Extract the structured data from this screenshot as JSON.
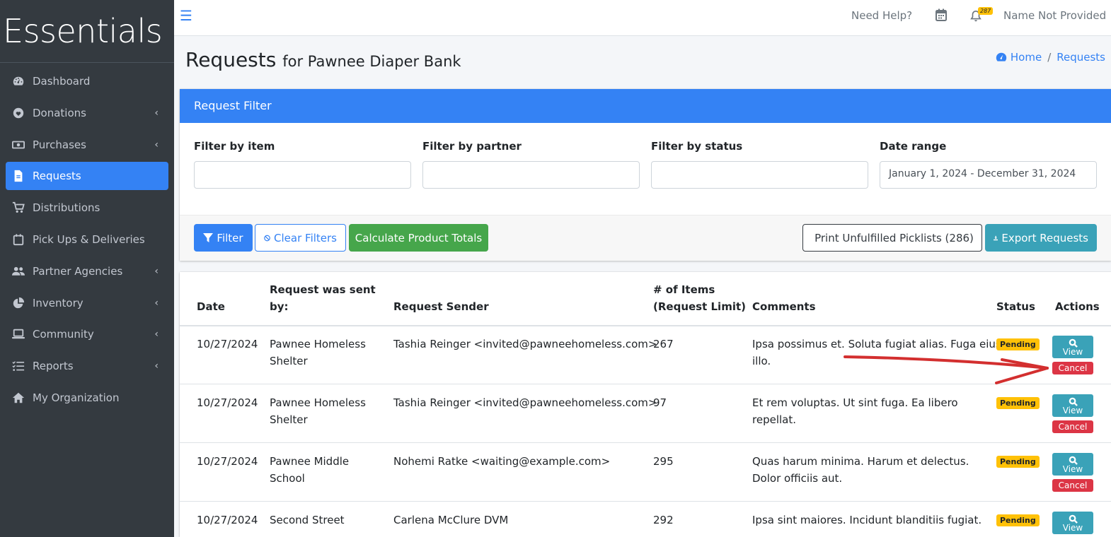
{
  "brand": {
    "name": "Essentials"
  },
  "sidebar": {
    "items": [
      {
        "label": "Dashboard",
        "icon": "dashboard-icon",
        "chevron": false,
        "active": false
      },
      {
        "label": "Donations",
        "icon": "heart-icon",
        "chevron": true,
        "active": false
      },
      {
        "label": "Purchases",
        "icon": "money-bill-icon",
        "chevron": true,
        "active": false
      },
      {
        "label": "Requests",
        "icon": "file-icon",
        "chevron": false,
        "active": true
      },
      {
        "label": "Distributions",
        "icon": "cart-icon",
        "chevron": false,
        "active": false
      },
      {
        "label": "Pick Ups & Deliveries",
        "icon": "calendar-icon",
        "chevron": false,
        "active": false
      },
      {
        "label": "Partner Agencies",
        "icon": "users-icon",
        "chevron": true,
        "active": false
      },
      {
        "label": "Inventory",
        "icon": "pie-chart-icon",
        "chevron": true,
        "active": false
      },
      {
        "label": "Community",
        "icon": "laptop-icon",
        "chevron": true,
        "active": false
      },
      {
        "label": "Reports",
        "icon": "list-check-icon",
        "chevron": true,
        "active": false
      },
      {
        "label": "My Organization",
        "icon": "home-icon",
        "chevron": false,
        "active": false
      }
    ]
  },
  "topbar": {
    "help_label": "Need Help?",
    "notification_count": "287",
    "user_name": "Name Not Provided"
  },
  "header": {
    "title": "Requests",
    "subtitle": "for Pawnee Diaper Bank",
    "breadcrumb": {
      "home": "Home",
      "current": "Requests"
    }
  },
  "filter": {
    "title": "Request Filter",
    "item_label": "Filter by item",
    "item_value": "",
    "partner_label": "Filter by partner",
    "partner_value": "",
    "status_label": "Filter by status",
    "status_value": "",
    "date_label": "Date range",
    "date_value": "January 1, 2024 - December 31, 2024",
    "filter_button": "Filter",
    "clear_button": "Clear Filters",
    "calculate_button": "Calculate Product Totals",
    "print_button": "Print Unfulfilled Picklists (286)",
    "export_button": "Export Requests"
  },
  "table": {
    "headers": {
      "date": "Date",
      "sent_by_1": "Request was sent",
      "sent_by_2": "by:",
      "sender": "Request Sender",
      "items_1": "# of Items",
      "items_2": "(Request Limit)",
      "comments": "Comments",
      "status": "Status",
      "actions": "Actions"
    },
    "view_label": "View",
    "cancel_label": "Cancel",
    "rows": [
      {
        "date": "10/27/2024",
        "sent_by_1": "Pawnee Homeless",
        "sent_by_2": "Shelter",
        "sender": "Tashia Reinger <invited@pawneehomeless.com>",
        "items": "267",
        "comments_1": "Ipsa possimus et. Soluta fugiat alias. Fuga eius",
        "comments_2": "illo.",
        "status": "Pending"
      },
      {
        "date": "10/27/2024",
        "sent_by_1": "Pawnee Homeless",
        "sent_by_2": "Shelter",
        "sender": "Tashia Reinger <invited@pawneehomeless.com>",
        "items": "97",
        "comments_1": "Et rem voluptas. Ut sint fuga. Ea libero",
        "comments_2": "repellat.",
        "status": "Pending"
      },
      {
        "date": "10/27/2024",
        "sent_by_1": "Pawnee Middle",
        "sent_by_2": "School",
        "sender": "Nohemi Ratke <waiting@example.com>",
        "items": "295",
        "comments_1": "Quas harum minima. Harum et delectus.",
        "comments_2": "Dolor officiis aut.",
        "status": "Pending"
      },
      {
        "date": "10/27/2024",
        "sent_by_1": "Second Street",
        "sent_by_2": "",
        "sender": "Carlena McClure DVM",
        "items": "292",
        "comments_1": "Ipsa sint maiores. Incidunt blanditiis fugiat.",
        "comments_2": "",
        "status": "Pending"
      }
    ]
  },
  "colors": {
    "primary": "#3482f4",
    "sidebar_bg": "#343a40",
    "success": "#46a64b",
    "info": "#3aa2b8",
    "danger": "#dc3545",
    "warning": "#ffc107",
    "annotation_arrow": "#d32f2f"
  }
}
